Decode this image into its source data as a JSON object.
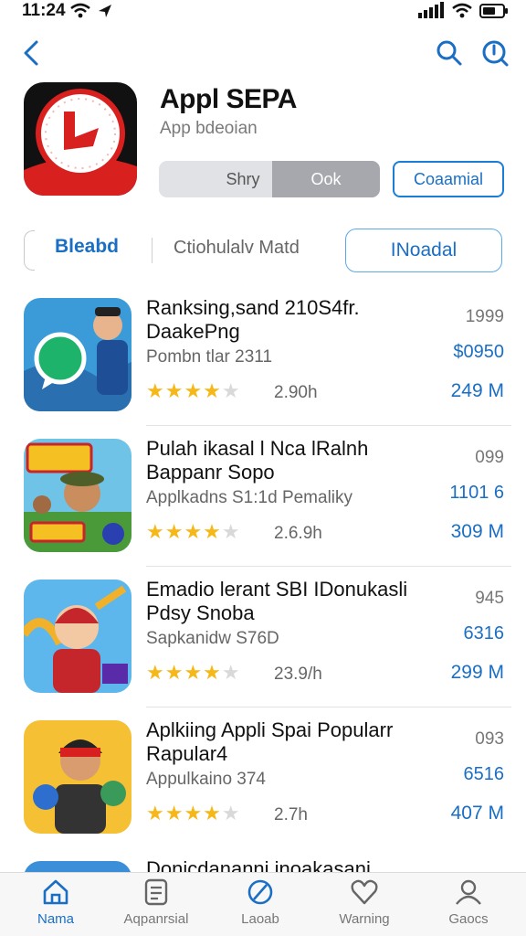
{
  "status": {
    "time": "11:24",
    "left_icons": [
      "wifi-icon",
      "location-arrow-icon"
    ],
    "right_icons": [
      "signal-icon",
      "wifi-icon",
      "battery-icon"
    ]
  },
  "nav": {
    "back_icon": "chevron-left-icon",
    "search_icon": "search-icon",
    "info_icon": "info-icon"
  },
  "app": {
    "title": "Appl SEPA",
    "subtitle": "App bdeoian",
    "segment_a": "Shry",
    "segment_b": "Ook",
    "get_label": "Coaamial",
    "icon_name": "clock-logo-icon"
  },
  "filters": {
    "item_1": "Bleabd",
    "item_2": "Ctiohulalv  Matd",
    "active": "INoadal"
  },
  "items": [
    {
      "name": "Ranksing,sand 210S4fr. DaakePng",
      "sub": "Pombn tlar 2311",
      "rating": "2.90h",
      "stars": 4,
      "count": "1999",
      "price": "$0950",
      "size": "249 M"
    },
    {
      "name": "Pulah ikasal l Nca lRalnh Bappanr Sopo",
      "sub": "Applkadns S1:1d Pemaliky",
      "rating": "2.6.9h",
      "stars": 3.5,
      "count": "099",
      "price": "1101 6",
      "size": "309 M"
    },
    {
      "name": "Emadio lerant SBI IDonukasli Pdsy Snoba",
      "sub": "Sapkanidw S76D",
      "rating": "23.9/h",
      "stars": 3.5,
      "count": "945",
      "price": "6316",
      "size": "299 M"
    },
    {
      "name": "Aplkiing Appli Spai Popularr Rapular4",
      "sub": "Appulkaino 374",
      "rating": "2.7h",
      "stars": 3.5,
      "count": "093",
      "price": "6516",
      "size": "407 M"
    }
  ],
  "partial_item": {
    "name": "Donicdananni inoakasani"
  },
  "tabs": [
    {
      "label": "Nama",
      "icon": "home-icon",
      "active": true
    },
    {
      "label": "Aqpanrsial",
      "icon": "apps-icon",
      "active": false
    },
    {
      "label": "Laoab",
      "icon": "slash-circle-icon",
      "active": false
    },
    {
      "label": "Warning",
      "icon": "heart-icon",
      "active": false
    },
    {
      "label": "Gaocs",
      "icon": "person-icon",
      "active": false
    }
  ],
  "colors": {
    "accent": "#1a6fc4",
    "star": "#f6b818",
    "icon_red": "#d8201f"
  }
}
